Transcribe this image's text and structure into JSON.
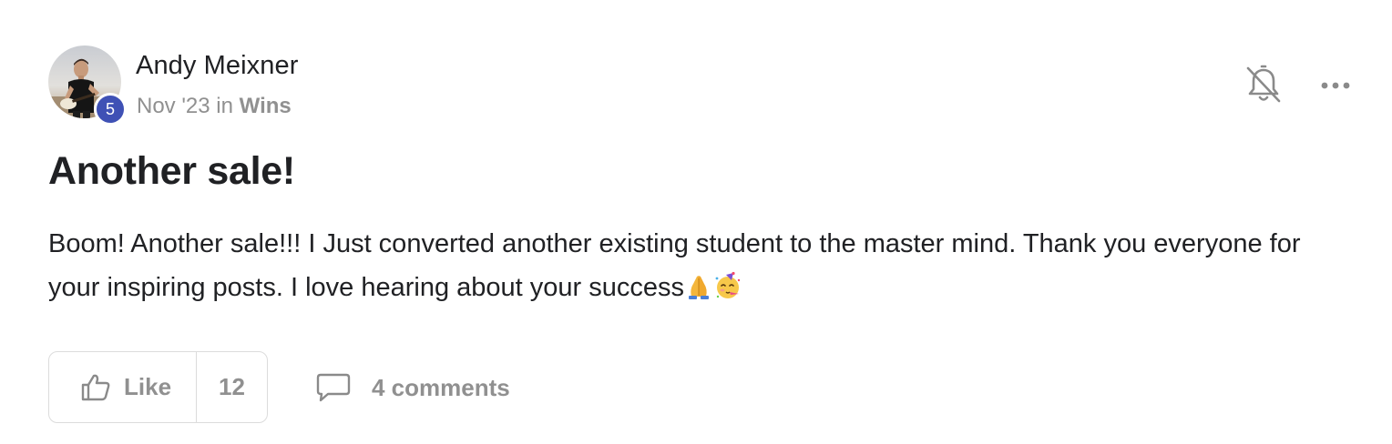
{
  "post": {
    "author": {
      "name": "Andy Meixner",
      "level": "5"
    },
    "meta": {
      "date": "Nov '23",
      "in_word": "in",
      "category": "Wins"
    },
    "title": "Another sale!",
    "body": "Boom! Another sale!!! I Just converted another existing student to the master mind. Thank you everyone for your inspiring posts. I love hearing about your success",
    "body_emojis": [
      "folded-hands-emoji",
      "partying-face-emoji"
    ],
    "actions": {
      "like_label": "Like",
      "like_count": "12",
      "comments_label": "4 comments"
    },
    "icons": {
      "notification": "bell-off-icon",
      "more": "more-horizontal-icon",
      "like": "thumbs-up-icon",
      "comment": "comment-bubble-icon"
    },
    "colors": {
      "level_badge": "#3f51b5",
      "muted_text": "#909090",
      "primary_text": "#202124",
      "border": "#dcdcdc"
    }
  }
}
